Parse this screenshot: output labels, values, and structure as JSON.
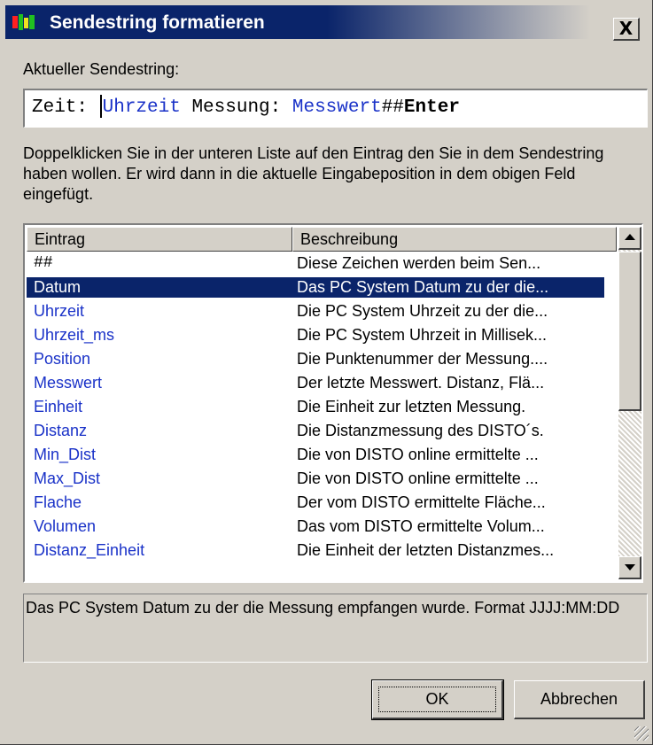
{
  "window": {
    "title": "Sendestring formatieren",
    "close_label": "X"
  },
  "current": {
    "label": "Aktueller Sendestring:",
    "tokens": [
      {
        "text": "Zeit: ",
        "style": "plain"
      },
      {
        "text": "Uhrzeit",
        "style": "blue"
      },
      {
        "text": " Messung: ",
        "style": "plain"
      },
      {
        "text": "Messwert",
        "style": "blue"
      },
      {
        "text": "##",
        "style": "plain"
      },
      {
        "text": "Enter",
        "style": "bold"
      }
    ]
  },
  "instructions": "Doppelklicken Sie in der unteren Liste auf den Eintrag den Sie in dem Sendestring haben wollen. Er wird dann in die aktuelle Eingabeposition in dem obigen Feld eingefügt.",
  "list": {
    "columns": [
      "Eintrag",
      "Beschreibung"
    ],
    "rows": [
      {
        "entry": "##",
        "description": "Diese Zeichen werden beim Sen...",
        "style": "mono"
      },
      {
        "entry": "Datum",
        "description": "Das PC System Datum zu der die...",
        "style": "selected"
      },
      {
        "entry": "Uhrzeit",
        "description": "Die PC System Uhrzeit zu der die...",
        "style": "blue"
      },
      {
        "entry": "Uhrzeit_ms",
        "description": "Die PC System Uhrzeit in Millisek...",
        "style": "blue"
      },
      {
        "entry": "Position",
        "description": "Die Punktenummer der Messung....",
        "style": "blue"
      },
      {
        "entry": "Messwert",
        "description": "Der letzte Messwert. Distanz, Flä...",
        "style": "blue"
      },
      {
        "entry": "Einheit",
        "description": "Die Einheit zur letzten Messung.",
        "style": "blue"
      },
      {
        "entry": "Distanz",
        "description": "Die Distanzmessung des DISTO´s.",
        "style": "blue"
      },
      {
        "entry": "Min_Dist",
        "description": "Die von DISTO online ermittelte ...",
        "style": "blue"
      },
      {
        "entry": "Max_Dist",
        "description": "Die von DISTO online ermittelte ...",
        "style": "blue"
      },
      {
        "entry": "Flache",
        "description": "Der vom DISTO ermittelte Fläche...",
        "style": "blue"
      },
      {
        "entry": "Volumen",
        "description": "Das vom DISTO ermittelte Volum...",
        "style": "blue"
      },
      {
        "entry": "Distanz_Einheit",
        "description": "Die Einheit der letzten Distanzmes...",
        "style": "blue"
      }
    ],
    "scroll_up_icon": "arrow-up-icon",
    "scroll_down_icon": "arrow-down-icon"
  },
  "info": "Das PC System Datum zu der die Messung empfangen wurde. Format JJJJ:MM:DD",
  "buttons": {
    "ok": "OK",
    "cancel": "Abbrechen"
  },
  "colors": {
    "title_bar": "#0a246a",
    "selection": "#0a246a",
    "variable_text": "#1a32c8",
    "face": "#d4d0c8"
  }
}
